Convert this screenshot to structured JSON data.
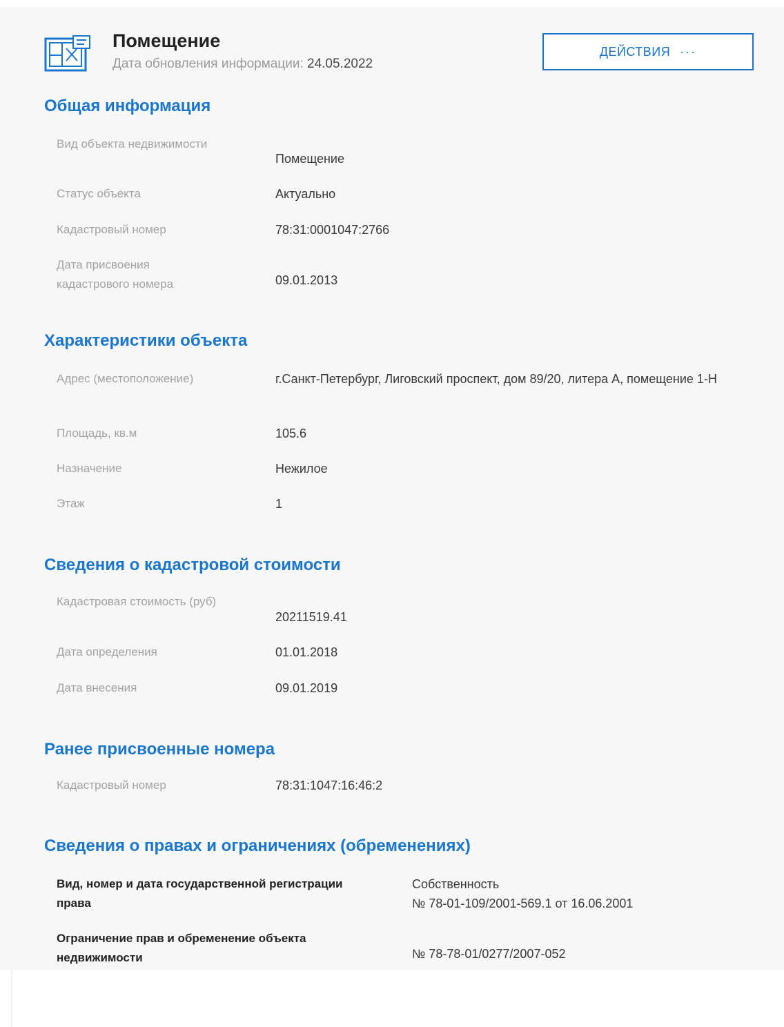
{
  "header": {
    "title": "Помещение",
    "update_label": "Дата обновления информации:",
    "update_date": "24.05.2022",
    "actions_label": "ДЕЙСТВИЯ",
    "actions_dots": "···",
    "icon": "building-plan-icon"
  },
  "general": {
    "title": "Общая информация",
    "rows": [
      {
        "label": "Вид объекта недвижимости",
        "value": "Помещение"
      },
      {
        "label": "Статус объекта",
        "value": "Актуально"
      },
      {
        "label": "Кадастровый номер",
        "value": "78:31:0001047:2766"
      },
      {
        "label": "Дата присвоения кадастрового номера",
        "value": "09.01.2013"
      }
    ]
  },
  "characteristics": {
    "title": "Характеристики объекта",
    "rows": [
      {
        "label": "Адрес (местоположение)",
        "value": "г.Санкт-Петербург, Лиговский проспект, дом 89/20, литера А, помещение 1-Н"
      },
      {
        "label": "Площадь, кв.м",
        "value": "105.6"
      },
      {
        "label": "Назначение",
        "value": "Нежилое"
      },
      {
        "label": "Этаж",
        "value": "1"
      }
    ]
  },
  "cadastral_value": {
    "title": "Сведения о кадастровой стоимости",
    "rows": [
      {
        "label": "Кадастровая стоимость (руб)",
        "value": "20211519.41"
      },
      {
        "label": "Дата определения",
        "value": "01.01.2018"
      },
      {
        "label": "Дата внесения",
        "value": "09.01.2019"
      }
    ]
  },
  "previous_numbers": {
    "title": "Ранее присвоенные номера",
    "rows": [
      {
        "label": "Кадастровый номер",
        "value": "78:31:1047:16:46:2"
      }
    ]
  },
  "rights": {
    "title": "Сведения о правах и ограничениях (обременениях)",
    "rows": [
      {
        "label": "Вид, номер и дата государственной регистрации права",
        "value_line1": "Собственность",
        "value_line2": "№ 78-01-109/2001-569.1 от 16.06.2001"
      },
      {
        "label": "Ограничение прав и обременение объекта недвижимости",
        "value_line1": "№ 78-78-01/0277/2007-052"
      }
    ]
  },
  "colors": {
    "accent": "#1b76cd",
    "label": "#a3a3a3",
    "card_bg": "#f7f7f8"
  }
}
